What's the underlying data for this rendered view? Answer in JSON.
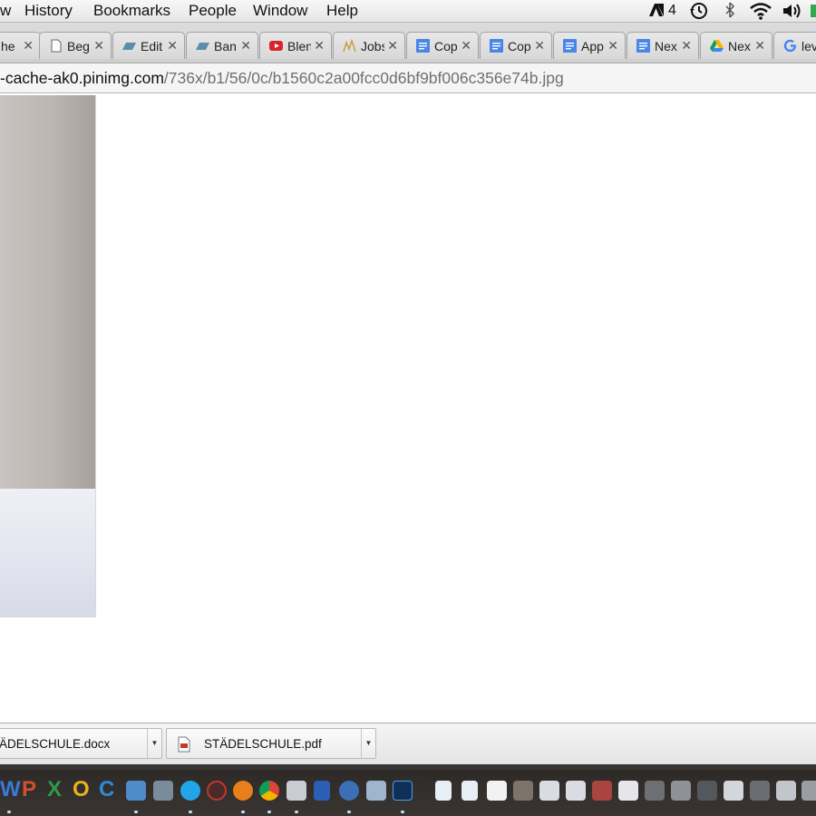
{
  "menubar": {
    "items": [
      "w",
      "History",
      "Bookmarks",
      "People",
      "Window",
      "Help"
    ],
    "status": {
      "adobe_badge": "4"
    }
  },
  "tabs": [
    {
      "title": "he",
      "icon": "page-icon"
    },
    {
      "title": "Beg",
      "icon": "document-icon"
    },
    {
      "title": "Edit",
      "icon": "blue-parallelogram-icon"
    },
    {
      "title": "Ban",
      "icon": "blue-parallelogram-icon"
    },
    {
      "title": "Blen",
      "icon": "youtube-icon"
    },
    {
      "title": "Jobs",
      "icon": "chart-icon"
    },
    {
      "title": "Cop",
      "icon": "google-docs-icon"
    },
    {
      "title": "Cop",
      "icon": "google-docs-icon"
    },
    {
      "title": "App",
      "icon": "google-docs-icon"
    },
    {
      "title": "Nex",
      "icon": "google-docs-icon"
    },
    {
      "title": "Nex",
      "icon": "google-drive-icon"
    },
    {
      "title": "lev",
      "icon": "google-icon"
    }
  ],
  "omnibox": {
    "host": "-cache-ak0.pinimg.com",
    "path": "/736x/b1/56/0c/b1560c2a00fcc0d6bf9bf006c356e74b.jpg"
  },
  "downloads": [
    {
      "name": "ÄDELSCHULE.docx"
    },
    {
      "name": "STÄDELSCHULE.pdf"
    }
  ],
  "colors": {
    "photo_wall": "#bdb5b2",
    "accent_blue": "#4a86e8"
  }
}
